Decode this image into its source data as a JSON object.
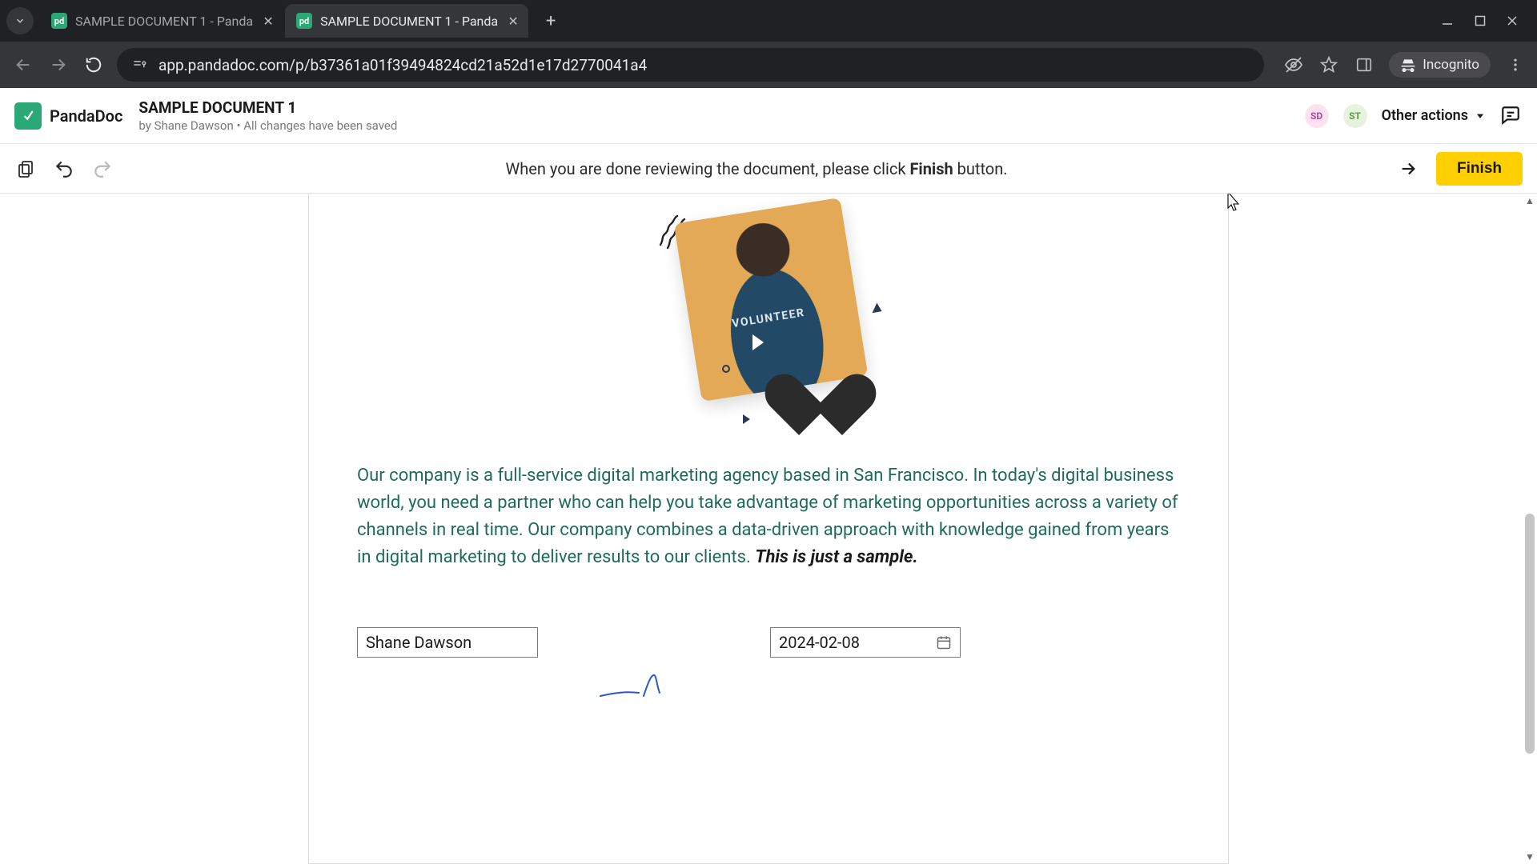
{
  "browser": {
    "tabs": [
      {
        "title": "SAMPLE DOCUMENT 1 - Panda",
        "favicon_label": "pd",
        "active": false
      },
      {
        "title": "SAMPLE DOCUMENT 1 - Panda",
        "favicon_label": "pd",
        "active": true
      }
    ],
    "url": "app.pandadoc.com/p/b37361a01f39494824cd21a52d1e17d2770041a4",
    "incognito_label": "Incognito"
  },
  "header": {
    "brand_name": "PandaDoc",
    "brand_mark_glyph": "↪",
    "doc_title": "SAMPLE DOCUMENT 1",
    "byline_prefix": "by ",
    "author": "Shane Dawson",
    "byline_separator": " • ",
    "saved_status": "All changes have been saved",
    "avatars": [
      "SD",
      "ST"
    ],
    "other_actions_label": "Other actions"
  },
  "review_bar": {
    "message_pre": "When you are done reviewing the document, please click ",
    "message_bold": "Finish",
    "message_post": " button.",
    "finish_label": "Finish"
  },
  "document": {
    "illustration_shirt_text": "VOLUNTEER",
    "body_pre": "Our company is a full-service digital marketing agency based in San Francisco. In today's digital business world, you need a partner who can help you take advantage of marketing opportunities across a variety of channels in real time. Our company combines a data-driven approach with knowledge gained from years in digital marketing to deliver results to our clients. ",
    "body_sample": "This is just a sample.",
    "name_field_value": "Shane Dawson",
    "date_field_value": "2024-02-08"
  },
  "colors": {
    "brand_green": "#2aa876",
    "finish_yellow": "#ffcf00",
    "body_text": "#1f6b5a"
  }
}
